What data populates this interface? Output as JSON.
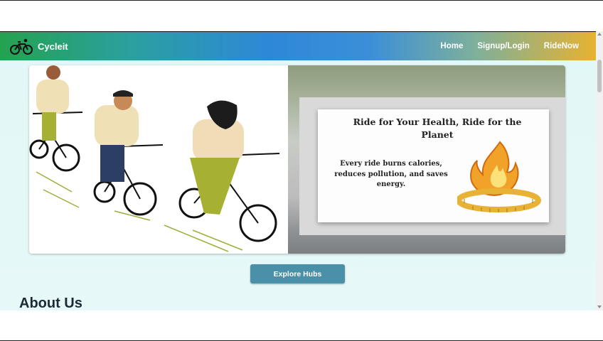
{
  "navbar": {
    "brand": "Cycleit",
    "links": [
      "Home",
      "Signup/Login",
      "RideNow"
    ]
  },
  "hero": {
    "card_title": "Ride for Your Health, Ride for the Planet",
    "card_body": "Every ride burns calories, reduces pollution, and saves energy."
  },
  "cta": {
    "label": "Explore Hubs"
  },
  "about": {
    "heading": "About Us"
  },
  "icons": [
    "bicycle-logo-icon",
    "flame-icon",
    "measuring-tape-icon",
    "scroll-up-arrow-icon",
    "scroll-down-arrow-icon"
  ],
  "colors": {
    "button": "#4a90a8",
    "nav_start": "#25a24f",
    "nav_mid": "#2e88d8",
    "nav_end": "#e7b232"
  }
}
